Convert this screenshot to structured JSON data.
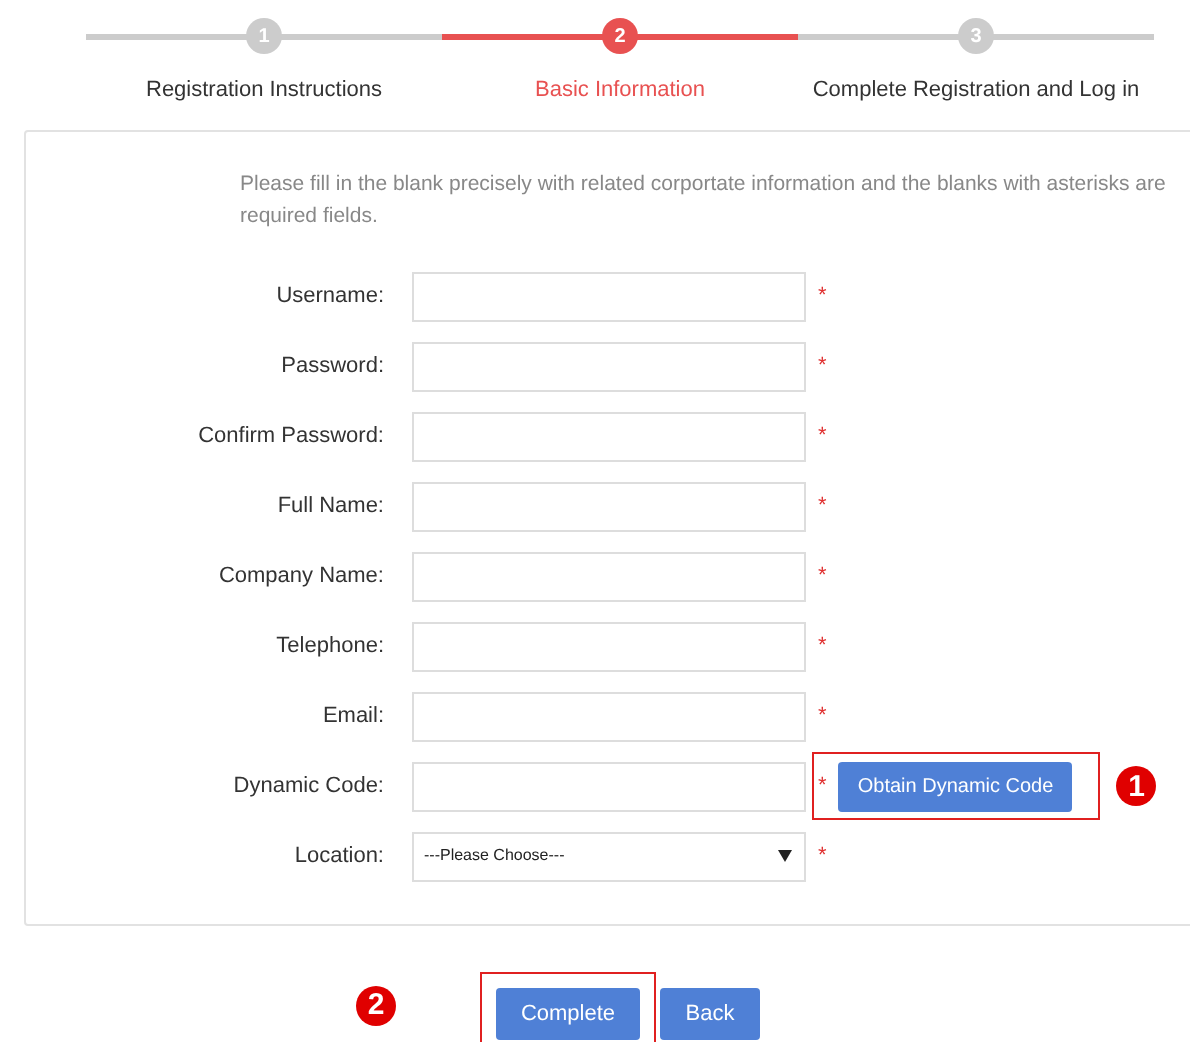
{
  "steps": [
    {
      "number": "1",
      "label": "Registration Instructions",
      "selected": false
    },
    {
      "number": "2",
      "label": "Basic Information",
      "selected": true
    },
    {
      "number": "3",
      "label": "Complete Registration and Log in",
      "selected": false
    }
  ],
  "intro": "Please fill in the blank precisely with related corportate information and the blanks with asterisks are required fields.",
  "fields": [
    {
      "kind": "text",
      "label": "Username:",
      "required_mark": "*"
    },
    {
      "kind": "text",
      "label": "Password:",
      "required_mark": "*"
    },
    {
      "kind": "text",
      "label": "Confirm Password:",
      "required_mark": "*"
    },
    {
      "kind": "text",
      "label": "Full Name:",
      "required_mark": "*"
    },
    {
      "kind": "text",
      "label": "Company Name:",
      "required_mark": "*"
    },
    {
      "kind": "text",
      "label": "Telephone:",
      "required_mark": "*"
    },
    {
      "kind": "text",
      "label": "Email:",
      "required_mark": "*"
    },
    {
      "kind": "code",
      "label": "Dynamic Code:",
      "required_mark": "*",
      "button": {
        "label": "Obtain Dynamic Code",
        "highlighted": true,
        "callout": "1"
      }
    },
    {
      "kind": "select",
      "label": "Location:",
      "required_mark": "*",
      "value": "---Please Choose---"
    }
  ],
  "actions": [
    {
      "label": "Complete",
      "highlighted": true,
      "callout": "2"
    },
    {
      "label": "Back"
    }
  ]
}
